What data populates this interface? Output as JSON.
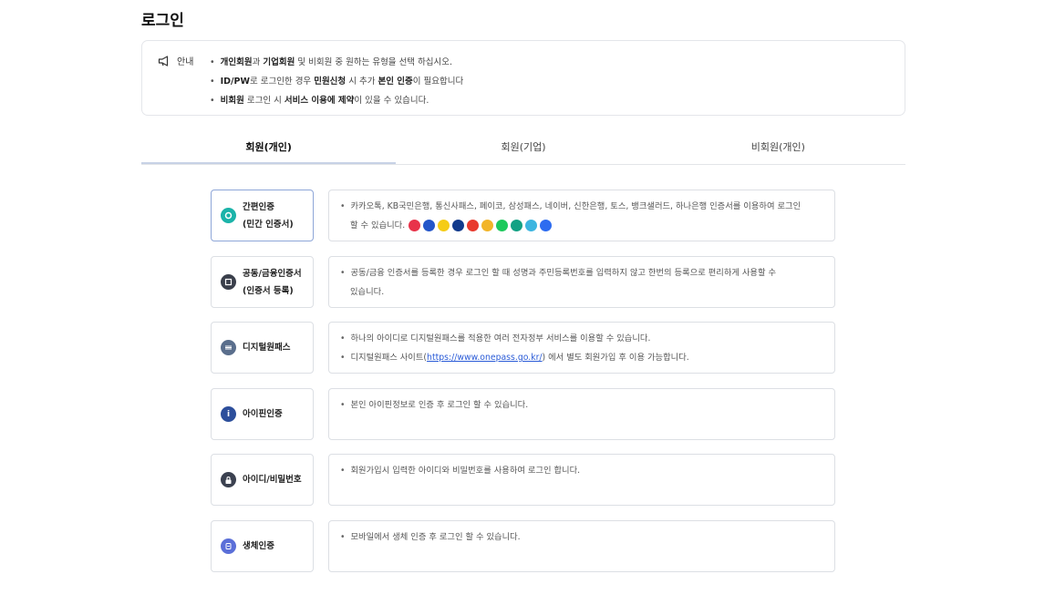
{
  "page": {
    "title": "로그인"
  },
  "notice": {
    "label": "안내",
    "items": [
      {
        "p1": "",
        "b1": "개인회원",
        "p2": "과 ",
        "b2": "기업회원",
        "p3": " 및 비회원 중 원하는 유형을 선택 하십시오."
      },
      {
        "p1": "",
        "b1": "ID/PW",
        "p2": "로 로그인한 경우 ",
        "b2": "민원신청",
        "p3": " 시 추가 ",
        "b3": "본인 인증",
        "p4": "이 필요합니다"
      },
      {
        "p1": "",
        "b1": "비회원",
        "p2": " 로그인 시 ",
        "b2": "서비스 이용에 제약",
        "p3": "이 있을 수 있습니다."
      }
    ]
  },
  "tabs": [
    {
      "label": "회원(개인)",
      "active": true
    },
    {
      "label": "회원(기업)",
      "active": false
    },
    {
      "label": "비회원(개인)",
      "active": false
    }
  ],
  "methods": [
    {
      "label_line1": "간편인증",
      "label_line2": "(민간 인증서)",
      "icon": "simple-auth-icon",
      "icon_color": "#1bb3a9",
      "lines": [
        "카카오톡, KB국민은행, 통신사패스, 페이코, 삼성패스, 네이버, 신한은행, 토스, 뱅크샐러드, 하나은행 인증서를 이용하여 로그인",
        "할 수 있습니다."
      ]
    },
    {
      "label_line1": "공동/금융인증서",
      "label_line2": "(인증서 등록)",
      "icon": "certificate-icon",
      "icon_color": "#3a3f4b",
      "lines": [
        "공동/금융 인증서를 등록한 경우 로그인 할 때 성명과 주민등록번호를 입력하지 않고 한번의 등록으로 편리하게 사용할 수",
        "있습니다."
      ]
    },
    {
      "label_line1": "디지털원패스",
      "icon": "digital-onepass-icon",
      "icon_color": "#5a6e8c",
      "lines": [
        "하나의 아이디로 디지털원패스를 적용한 여러 전자정부 서비스를 이용할 수 있습니다."
      ],
      "link_prefix": "디지털원패스 사이트(",
      "link_text": "https://www.onepass.go.kr/",
      "link_suffix": ") 에서 별도 회원가입 후 이용 가능합니다."
    },
    {
      "label_line1": "아이핀인증",
      "icon": "ipin-icon",
      "icon_color": "#2c4e9b",
      "lines": [
        "본인 아이핀정보로 인증 후 로그인 할 수 있습니다."
      ]
    },
    {
      "label_line1": "아이디/비밀번호",
      "icon": "lock-icon",
      "icon_color": "#3b4150",
      "lines": [
        "회원가입시 입력한 아이디와 비밀번호를 사용하여 로그인 합니다."
      ]
    },
    {
      "label_line1": "생체인증",
      "icon": "biometric-icon",
      "icon_color": "#5b6fd8",
      "lines": [
        "모바일에서 생체 인증 후 로그인 할 수 있습니다."
      ]
    }
  ],
  "cert_providers": [
    {
      "icon": "cert-provider-1-icon",
      "color": "#e8334a"
    },
    {
      "icon": "cert-provider-2-icon",
      "color": "#2456c9"
    },
    {
      "icon": "cert-provider-3-icon",
      "color": "#f5cc16"
    },
    {
      "icon": "cert-provider-4-icon",
      "color": "#113a8c"
    },
    {
      "icon": "cert-provider-5-icon",
      "color": "#e83a2e"
    },
    {
      "icon": "cert-provider-6-icon",
      "color": "#f2b529"
    },
    {
      "icon": "cert-provider-7-icon",
      "color": "#1ec95c"
    },
    {
      "icon": "cert-provider-8-icon",
      "color": "#13a184"
    },
    {
      "icon": "cert-provider-9-icon",
      "color": "#3cb5e0"
    },
    {
      "icon": "cert-provider-10-icon",
      "color": "#2d6cf0"
    }
  ]
}
